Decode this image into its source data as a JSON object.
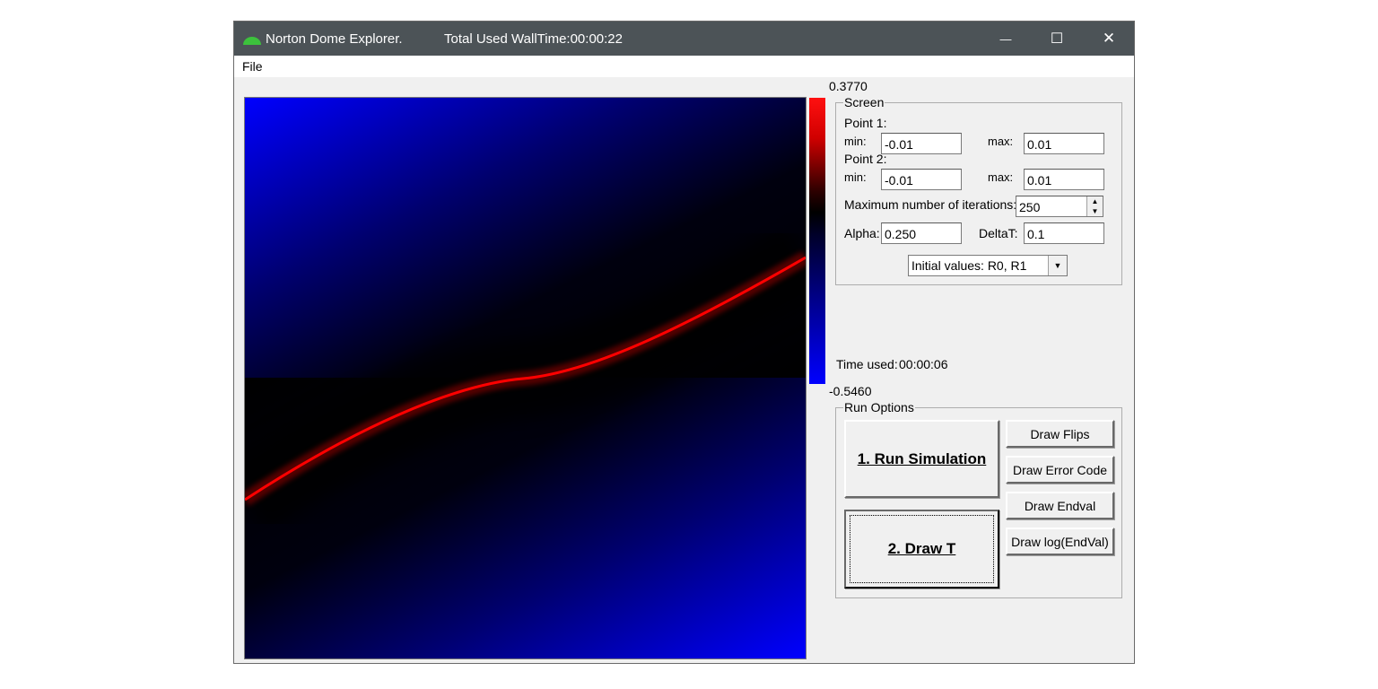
{
  "window": {
    "title": "Norton Dome Explorer.",
    "walltime": "Total Used WallTime:00:00:22",
    "controls": {
      "minimize": "—",
      "maximize": "☐",
      "close": "✕"
    }
  },
  "menu": {
    "file": "File"
  },
  "colorbar": {
    "max": "0.3770",
    "min": "-0.5460"
  },
  "screen": {
    "title": "Screen",
    "point1_label": "Point 1:",
    "point2_label": "Point 2:",
    "min_label": "min:",
    "max_label": "max:",
    "p1_min": "-0.01",
    "p1_max": "0.01",
    "p2_min": "-0.01",
    "p2_max": "0.01",
    "iter_label": "Maximum number of iterations:",
    "iter_value": "250",
    "alpha_label": "Alpha:",
    "alpha_value": "0.250",
    "deltat_label": "DeltaT:",
    "deltat_value": "0.1",
    "initial_values": "Initial values: R0, R1"
  },
  "time_used_label": "Time used:",
  "time_used_value": "00:00:06",
  "run_options": {
    "title": "Run Options",
    "run_simulation": "1. Run Simulation",
    "draw_t": "2. Draw T",
    "draw_flips": "Draw Flips",
    "draw_error_code": "Draw Error Code",
    "draw_endval": "Draw Endval",
    "draw_log_endval": "Draw log(EndVal)"
  },
  "colors": {
    "titlebar": "#4c5357",
    "curve": "#ff0000",
    "field_low": "#0000ff",
    "field_mid": "#000000"
  }
}
